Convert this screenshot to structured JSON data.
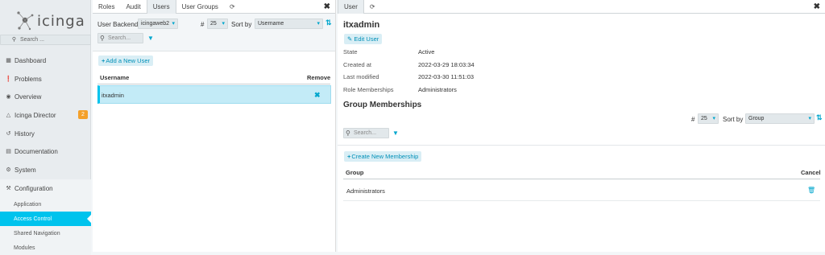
{
  "app": {
    "logo_text": "icinga"
  },
  "sidebar": {
    "search_label": "Search ...",
    "items": [
      {
        "label": "Dashboard",
        "icon": "dashboard-icon"
      },
      {
        "label": "Problems",
        "icon": "problems-icon"
      },
      {
        "label": "Overview",
        "icon": "binoculars-icon"
      },
      {
        "label": "Icinga Director",
        "icon": "director-icon",
        "badge": "2"
      },
      {
        "label": "History",
        "icon": "history-icon"
      },
      {
        "label": "Documentation",
        "icon": "book-icon"
      },
      {
        "label": "System",
        "icon": "gears-icon"
      },
      {
        "label": "Configuration",
        "icon": "wrench-icon"
      }
    ],
    "subitems": [
      {
        "label": "Application"
      },
      {
        "label": "Access Control"
      },
      {
        "label": "Shared Navigation"
      },
      {
        "label": "Modules"
      }
    ],
    "badge_color": "#f4a02a",
    "accent": "#00c3ed"
  },
  "left": {
    "tabs": [
      "Roles",
      "Audit",
      "Users",
      "User Groups"
    ],
    "user_backend_label": "User Backend",
    "user_backend_value": "icingaweb2",
    "limit_label": "#",
    "limit_value": "25",
    "sort_label": "Sort by",
    "sort_value": "Username",
    "search_placeholder": "Search...",
    "add_button": "Add a New User",
    "columns": [
      "Username",
      "Remove"
    ],
    "rows": [
      {
        "username": "itxadmin"
      }
    ]
  },
  "right": {
    "tabs": [
      "User"
    ],
    "username": "itxadmin",
    "edit_button": "Edit User",
    "fields": [
      {
        "key": "State",
        "value": "Active"
      },
      {
        "key": "Created at",
        "value": "2022-03-29 18:03:34"
      },
      {
        "key": "Last modified",
        "value": "2022-03-30 11:51:03"
      },
      {
        "key": "Role Memberships",
        "value": "Administrators"
      }
    ],
    "group_title": "Group Memberships",
    "limit_label": "#",
    "limit_value": "25",
    "sort_label": "Sort by",
    "sort_value": "Group",
    "search_placeholder": "Search...",
    "create_button": "Create New Membership",
    "columns": [
      "Group",
      "Cancel"
    ],
    "rows": [
      {
        "group": "Administrators"
      }
    ]
  }
}
